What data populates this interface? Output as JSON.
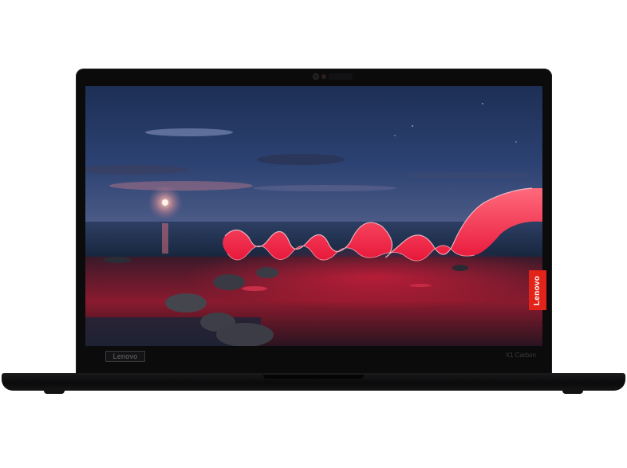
{
  "product": {
    "bezel_logo": "Lenovo",
    "bezel_model": "X1 Carbon",
    "side_tag": "Lenovo"
  },
  "colors": {
    "lid": "#0b0b0c",
    "accent_red": "#e2231a",
    "light_trail": "#ff2d4a"
  }
}
